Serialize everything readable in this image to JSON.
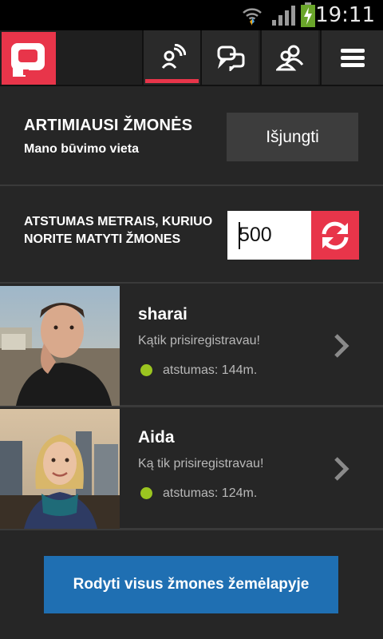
{
  "status_bar": {
    "time": "19:11",
    "icons": [
      "wifi-icon",
      "signal-icon",
      "battery-charging-icon"
    ]
  },
  "top_nav": {
    "logo": "chat-bubble-logo",
    "items": [
      {
        "icon": "nearby-signal-icon",
        "active": true
      },
      {
        "icon": "chat-bubbles-icon",
        "active": false
      },
      {
        "icon": "people-icon",
        "active": false
      },
      {
        "icon": "menu-icon",
        "active": false
      }
    ]
  },
  "nearby": {
    "title": "ARTIMIAUSI ŽMONĖS",
    "subtitle": "Mano būvimo vieta",
    "toggle_label": "Išjungti"
  },
  "distance": {
    "label": "ATSTUMAS METRAIS, KURIUO NORITE MATYTI ŽMONES",
    "value": "500",
    "refresh_icon": "refresh-icon"
  },
  "people": [
    {
      "name": "sharai",
      "status": "Kątik prisiregistravau!",
      "distance": "atstumas: 144m."
    },
    {
      "name": "Aida",
      "status": "Ką tik prisiregistravau!",
      "distance": "atstumas: 124m."
    }
  ],
  "map_button": {
    "label": "Rodyti visus žmones žemėlapyje"
  },
  "colors": {
    "accent": "#e8354a",
    "background": "#262626",
    "online": "#9bc520",
    "button_blue": "#1f6fb2"
  }
}
